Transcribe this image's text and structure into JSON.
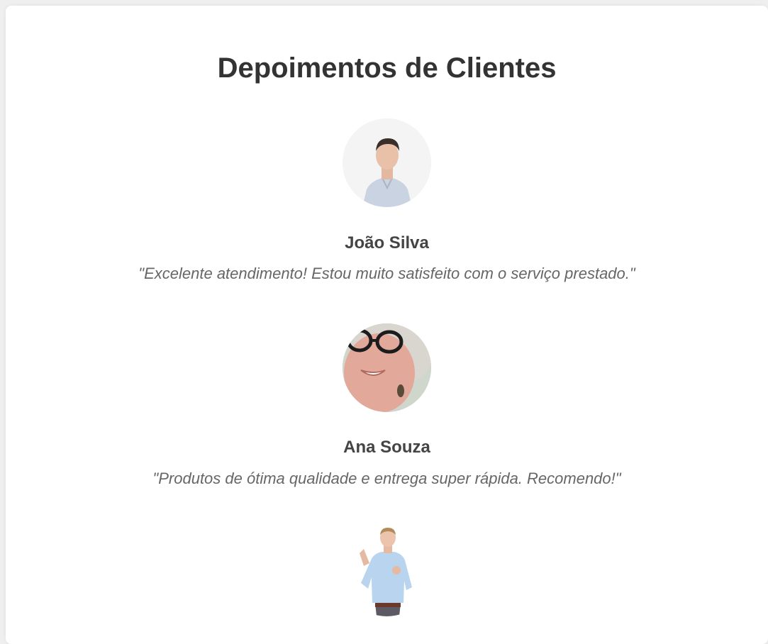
{
  "page": {
    "title": "Depoimentos de Clientes"
  },
  "testimonials": [
    {
      "name": "João Silva",
      "quote": "\"Excelente atendimento! Estou muito satisfeito com o serviço prestado.\"",
      "avatar_icon": "man-portrait-photo"
    },
    {
      "name": "Ana Souza",
      "quote": "\"Produtos de ótima qualidade e entrega super rápida. Recomendo!\"",
      "avatar_icon": "woman-portrait-photo"
    },
    {
      "avatar_icon": "man-gesturing-photo"
    }
  ],
  "colors": {
    "background": "#efefef",
    "card": "#ffffff",
    "title": "#333333",
    "name": "#444444",
    "quote": "#666666"
  }
}
